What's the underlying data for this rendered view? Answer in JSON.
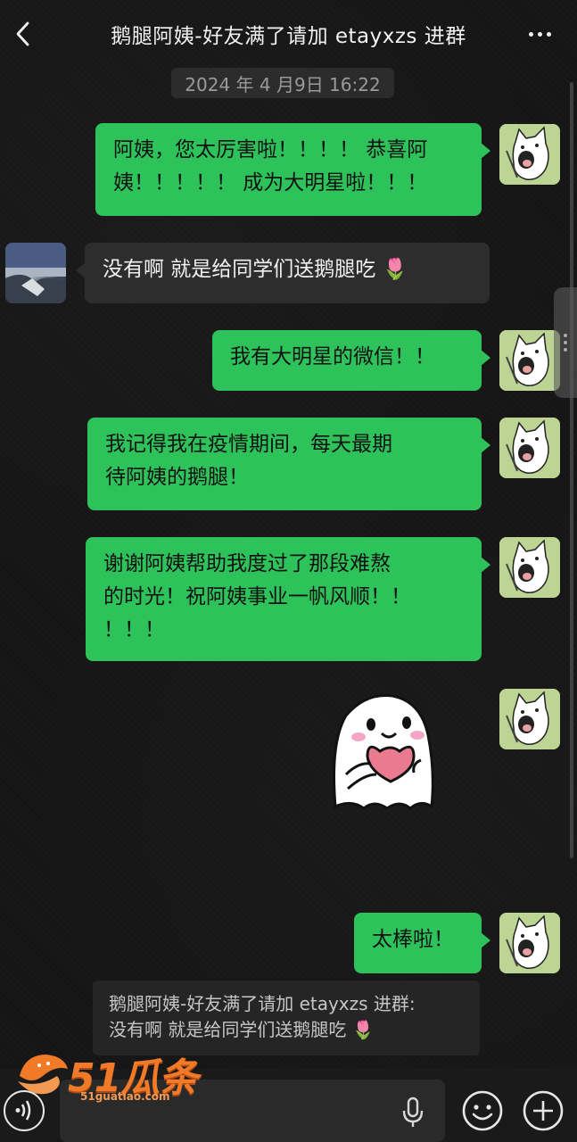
{
  "header": {
    "title": "鹅腿阿姨-好友满了请加 etayxzs 进群"
  },
  "timestamp": "2024 年 4 月9日 16:22",
  "messages": [
    {
      "side": "me",
      "lines": [
        "阿姨，您太厉害啦！！！！ 恭喜阿",
        "姨！！！！！ 成为大明星啦！！！"
      ]
    },
    {
      "side": "other",
      "text": "没有啊 就是给同学们送鹅腿吃 🌷"
    },
    {
      "side": "me",
      "text": "我有大明星的微信！！"
    },
    {
      "side": "me",
      "lines": [
        "我记得我在疫情期间，每天最期",
        "待阿姨的鹅腿！"
      ]
    },
    {
      "side": "me",
      "lines": [
        "谢谢阿姨帮助我度过了那段难熬",
        "的时光！祝阿姨事业一帆风顺！！",
        "！！！"
      ]
    },
    {
      "side": "me",
      "text": "太棒啦！"
    }
  ],
  "quote": {
    "line1": "鹅腿阿姨-好友满了请加 etayxzs 进群:",
    "line2": "没有啊 就是给同学们送鹅腿吃 🌷"
  },
  "watermark": {
    "logo": "51瓜条",
    "url": "51guatiao.com"
  },
  "colors": {
    "bubble_me": "#2ec25b",
    "bubble_other": "#2d2d2d",
    "background": "#151515"
  }
}
